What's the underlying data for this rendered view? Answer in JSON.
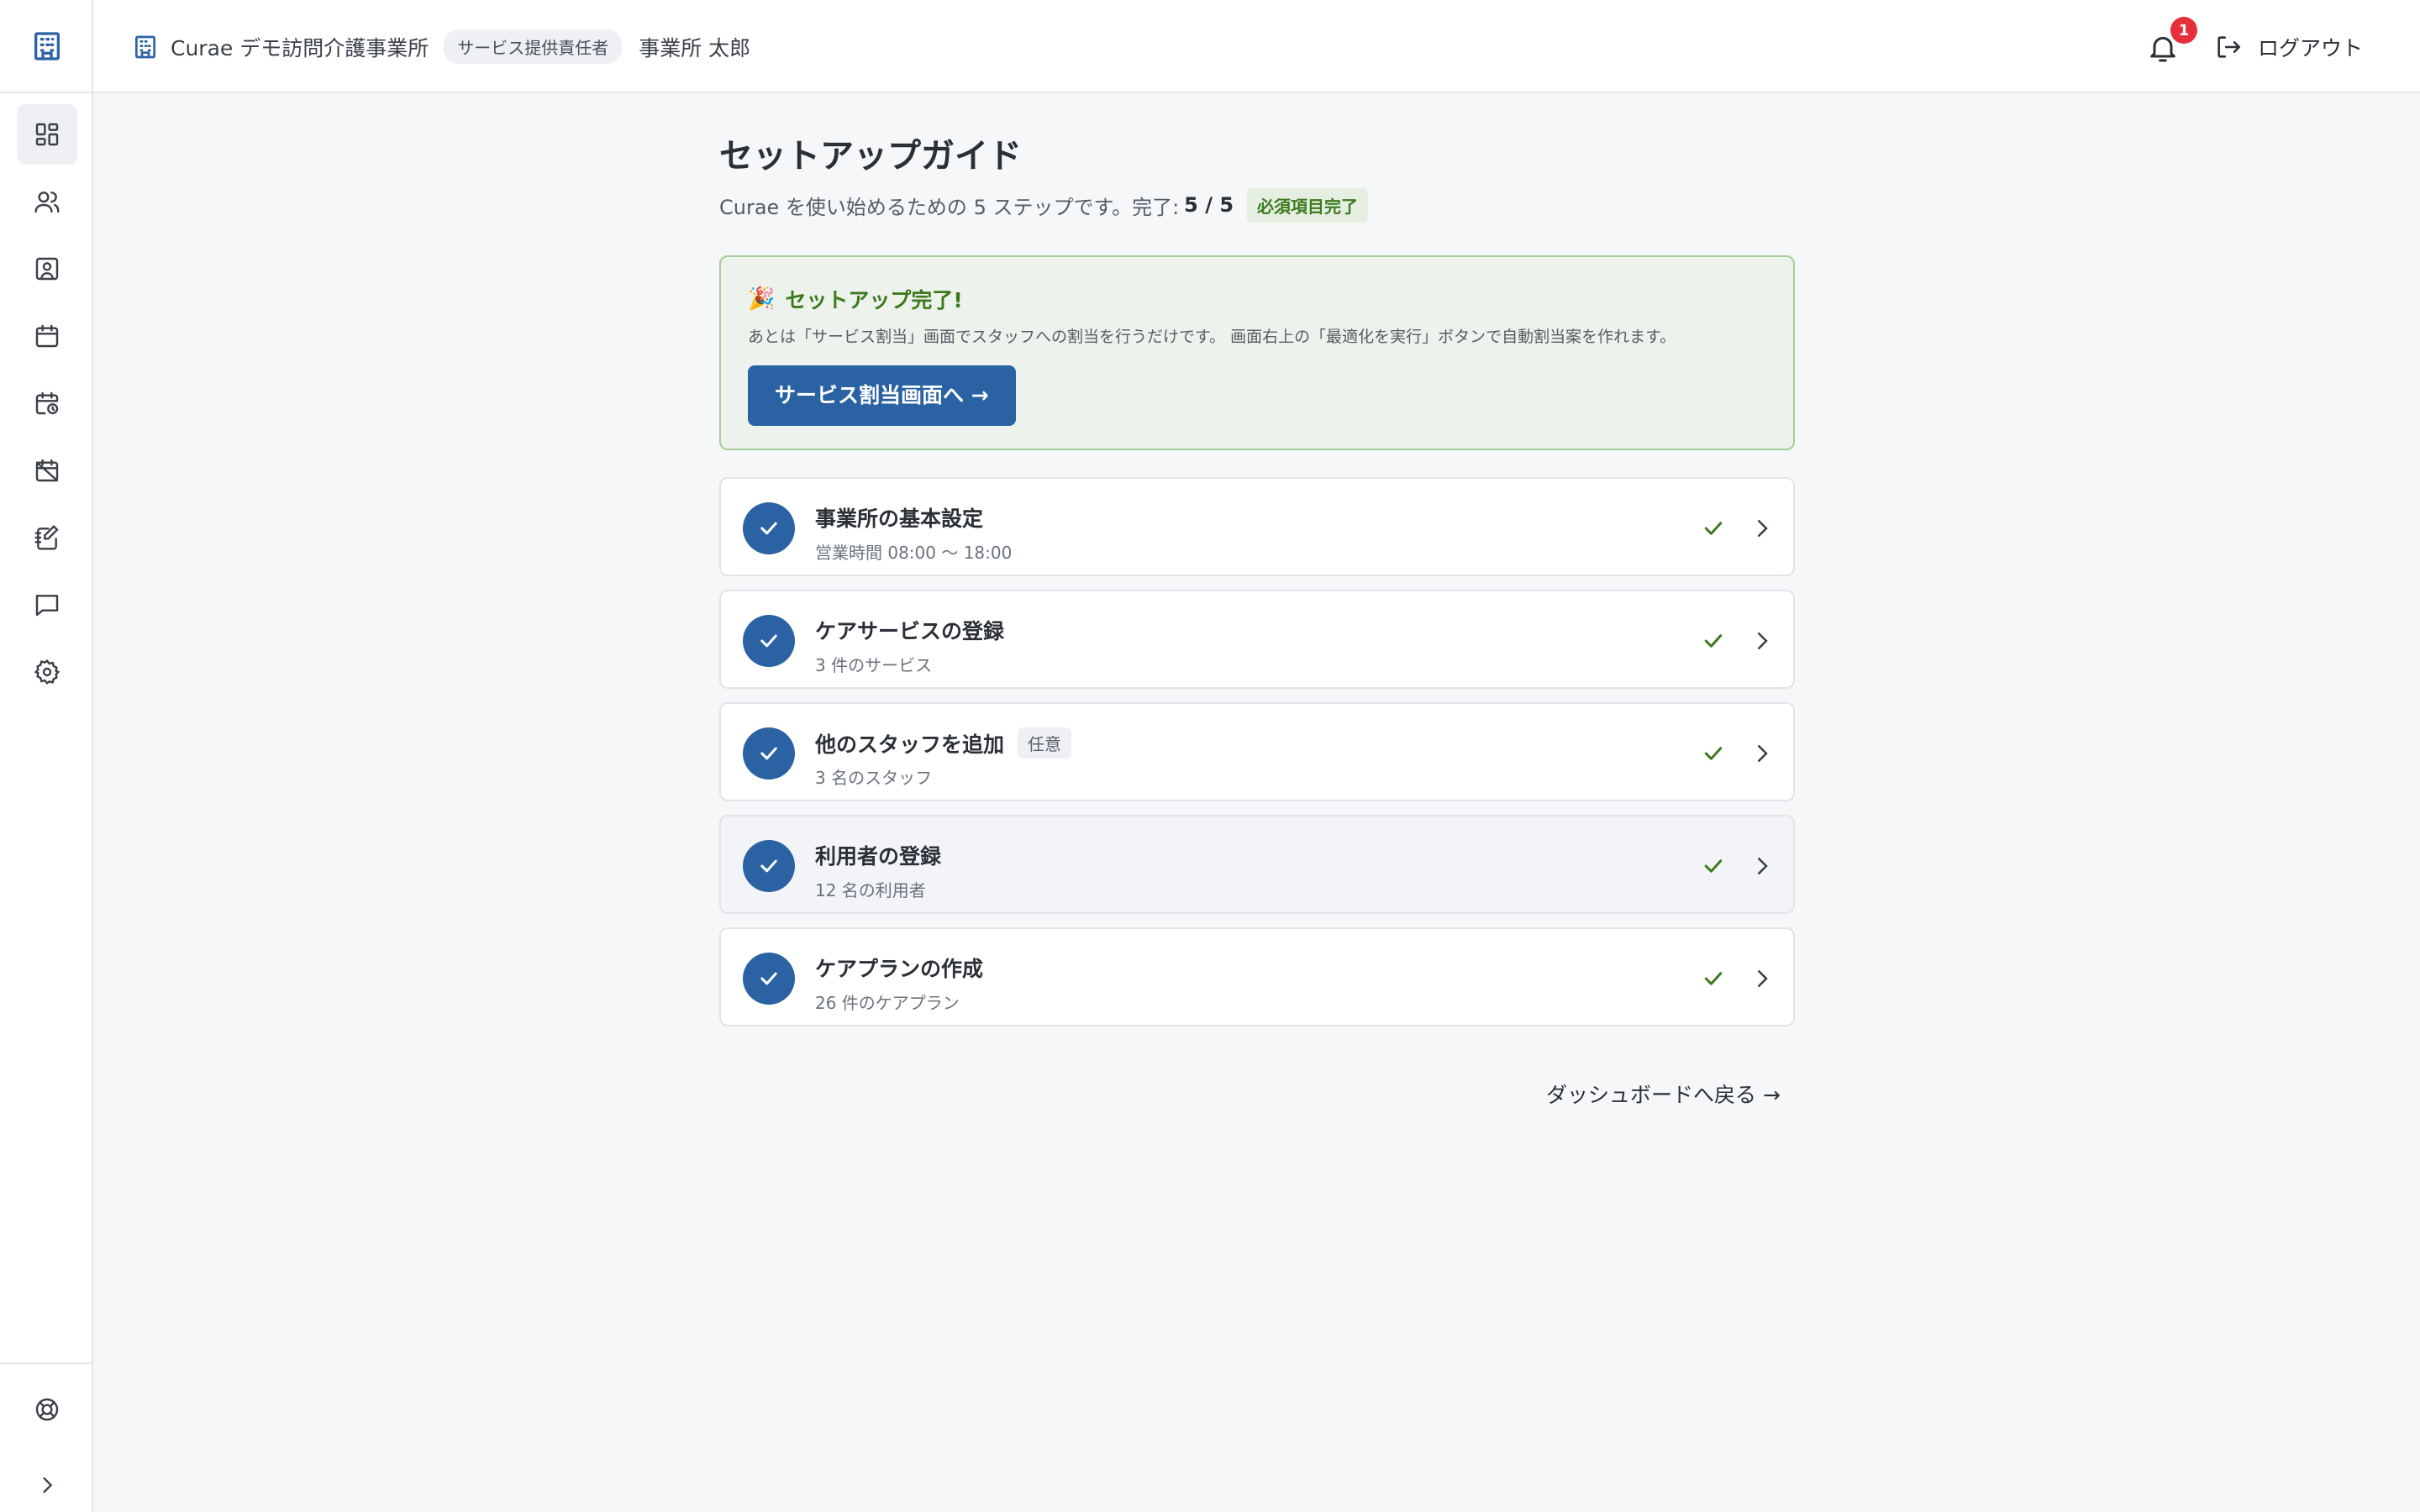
{
  "header": {
    "org_name": "Curae デモ訪問介護事業所",
    "role": "サービス提供責任者",
    "user_name": "事業所 太郎",
    "notification_count": "1",
    "logout_label": "ログアウト"
  },
  "sidebar": {
    "items": [
      {
        "icon": "dashboard-icon",
        "active": true
      },
      {
        "icon": "users-icon"
      },
      {
        "icon": "contact-card-icon"
      },
      {
        "icon": "calendar-icon"
      },
      {
        "icon": "calendar-clock-icon"
      },
      {
        "icon": "calendar-off-icon"
      },
      {
        "icon": "notebook-edit-icon"
      },
      {
        "icon": "chat-icon"
      },
      {
        "icon": "settings-icon"
      }
    ],
    "bottom": [
      {
        "icon": "help-lifebuoy-icon"
      },
      {
        "icon": "chevron-right-icon"
      }
    ]
  },
  "page": {
    "title": "セットアップガイド",
    "subtitle": "Curae を使い始めるための 5 ステップです。完了:",
    "progress": "5 / 5",
    "required_badge": "必須項目完了"
  },
  "banner": {
    "emoji": "🎉",
    "title": "セットアップ完了!",
    "text": "あとは「サービス割当」画面でスタッフへの割当を行うだけです。 画面右上の「最適化を実行」ボタンで自動割当案を作れます。",
    "button_label": "サービス割当画面へ →"
  },
  "steps": [
    {
      "title": "事業所の基本設定",
      "sub": "営業時間 08:00 〜 18:00",
      "optional": ""
    },
    {
      "title": "ケアサービスの登録",
      "sub": "3 件のサービス",
      "optional": ""
    },
    {
      "title": "他のスタッフを追加",
      "sub": "3 名のスタッフ",
      "optional": "任意"
    },
    {
      "title": "利用者の登録",
      "sub": "12 名の利用者",
      "optional": ""
    },
    {
      "title": "ケアプランの作成",
      "sub": "26 件のケアプラン",
      "optional": ""
    }
  ],
  "back_link": "ダッシュボードへ戻る →",
  "colors": {
    "primary": "#2b62a3",
    "success": "#3d7a1d",
    "success_bg": "#edf3ec",
    "notification": "#e5303c"
  }
}
